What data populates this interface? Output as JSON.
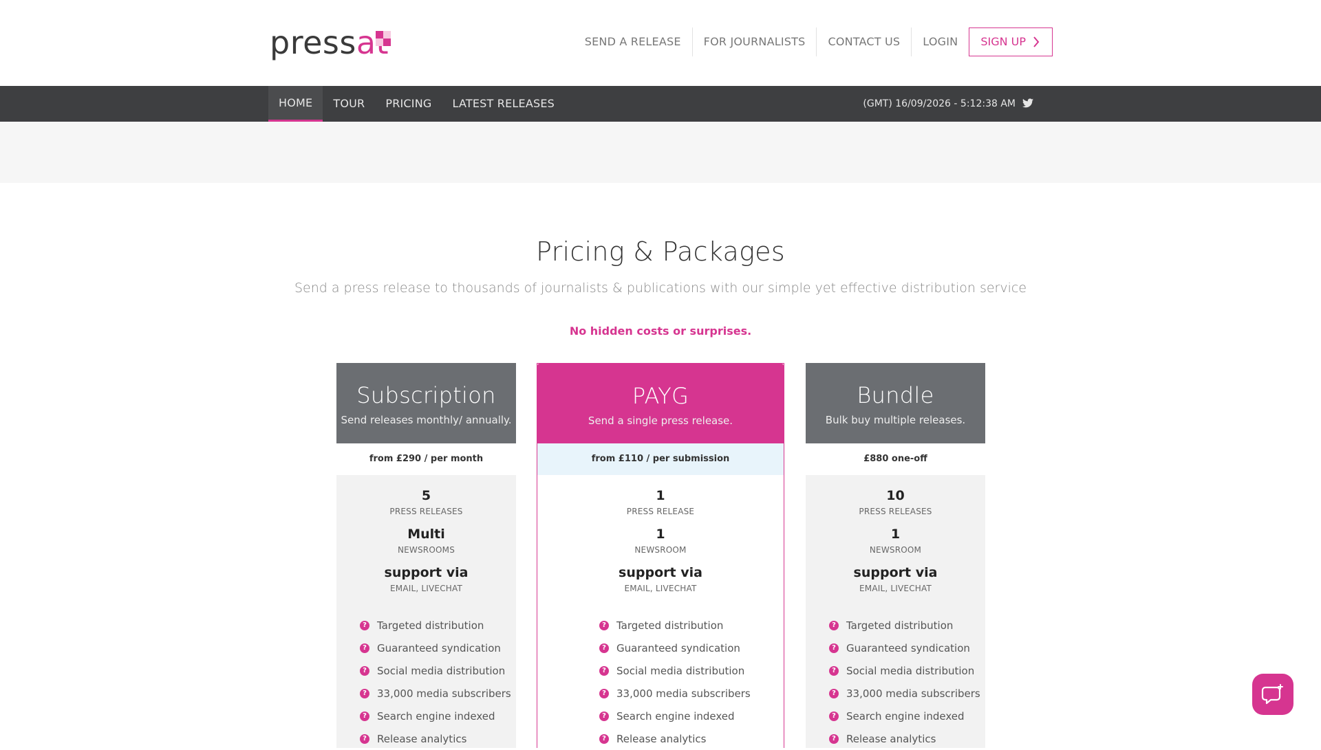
{
  "header": {
    "logo_text": "pressat",
    "nav": [
      {
        "label": "SEND A RELEASE"
      },
      {
        "label": "FOR JOURNALISTS"
      },
      {
        "label": "CONTACT US"
      },
      {
        "label": "LOGIN"
      }
    ],
    "signup_label": "SIGN UP"
  },
  "main_nav": {
    "tabs": [
      {
        "label": "HOME",
        "active": true
      },
      {
        "label": "TOUR"
      },
      {
        "label": "PRICING"
      },
      {
        "label": "LATEST RELEASES"
      }
    ],
    "clock": "(GMT) 16/09/2026 - 5:12:38 AM"
  },
  "pricing": {
    "title": "Pricing & Packages",
    "subtitle": "Send a press release to thousands of journalists & publications with our simple yet effective distribution service",
    "note": "No hidden costs or surprises."
  },
  "plans": [
    {
      "name": "Subscription",
      "desc": "Send releases monthly/ annually.",
      "price": "from £290 / per month",
      "stats": [
        {
          "num": "5",
          "label": "PRESS RELEASES"
        },
        {
          "num": "Multi",
          "label": "NEWSROOMS"
        },
        {
          "num": "support via",
          "label": "EMAIL, LIVECHAT"
        }
      ],
      "features": [
        "Targeted distribution",
        "Guaranteed syndication",
        "Social media distribution",
        "33,000 media subscribers",
        "Search engine indexed",
        "Release analytics"
      ]
    },
    {
      "name": "PAYG",
      "desc": "Send a single press release.",
      "price": "from £110 / per submission",
      "stats": [
        {
          "num": "1",
          "label": "PRESS RELEASE"
        },
        {
          "num": "1",
          "label": "NEWSROOM"
        },
        {
          "num": "support via",
          "label": "EMAIL, LIVECHAT"
        }
      ],
      "features": [
        "Targeted distribution",
        "Guaranteed syndication",
        "Social media distribution",
        "33,000 media subscribers",
        "Search engine indexed",
        "Release analytics"
      ]
    },
    {
      "name": "Bundle",
      "desc": "Bulk buy multiple releases.",
      "price": "£880 one-off",
      "stats": [
        {
          "num": "10",
          "label": "PRESS RELEASES"
        },
        {
          "num": "1",
          "label": "NEWSROOM"
        },
        {
          "num": "support via",
          "label": "EMAIL, LIVECHAT"
        }
      ],
      "features": [
        "Targeted distribution",
        "Guaranteed syndication",
        "Social media distribution",
        "33,000 media subscribers",
        "Search engine indexed",
        "Release analytics"
      ]
    }
  ],
  "feature_icon": "question-icon",
  "colors": {
    "brand": "#d63590",
    "nav_dark": "#3e3f41",
    "card_header_grey": "#6b6e72"
  }
}
